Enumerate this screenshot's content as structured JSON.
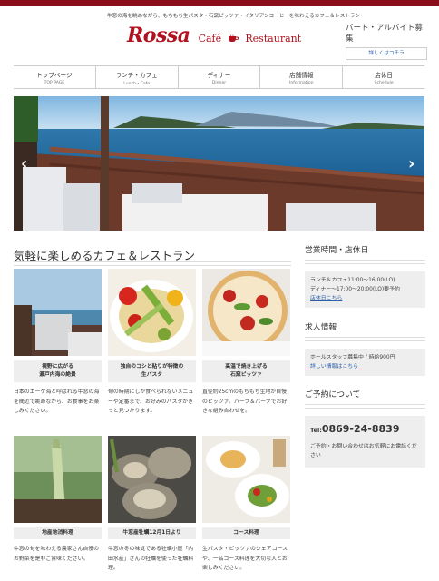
{
  "header": {
    "tagline": "牛窓の海を眺めながら、もちもち生パスタ・石窯ピッツァ・イタリアンコーヒーを味わえるカフェ＆レストラン",
    "logo_rossa": "Rossa",
    "logo_cafe": "Café",
    "logo_restaurant": "Restaurant",
    "recruit_title": "パート・アルバイト募集",
    "recruit_button": "詳しくはコチラ"
  },
  "nav": [
    {
      "ja": "トップページ",
      "en": "TOP PAGE"
    },
    {
      "ja": "ランチ・カフェ",
      "en": "Lunch・Cafe"
    },
    {
      "ja": "ディナー",
      "en": "Dinner"
    },
    {
      "ja": "店舗情報",
      "en": "Information"
    },
    {
      "ja": "店休日",
      "en": "Schedule"
    }
  ],
  "hero": {
    "prev": "‹",
    "next": "›"
  },
  "main": {
    "title": "気軽に楽しめるカフェ＆レストラン",
    "cards": [
      {
        "cap1": "視野に広がる",
        "cap2": "瀬戸内海の絶景",
        "desc": "日本のエーゲ海と呼ばれる牛窓の海を間近で眺めながら、お食事をお楽しみください。"
      },
      {
        "cap1": "独自のコシと粘りが特徴の",
        "cap2": "生パスタ",
        "desc": "旬の時期にしか食べられないメニューや定番まで、お好みのパスタがきっと見つかります。"
      },
      {
        "cap1": "高温で焼き上げる",
        "cap2": "石窯ピッツァ",
        "desc": "直径約25cmのもちもち生地が自慢のピッツァ。ハーブ＆パーブでお好きな組み合わせを。"
      },
      {
        "cap1": "地産地消料理",
        "cap2": "",
        "desc": "牛窓の旬を味わえる農家さん自慢のお野菜を是非ご賞味ください。"
      },
      {
        "cap1": "牛窓産牡蠣12月1日より",
        "cap2": "",
        "desc": "牛窓の冬の味覚である牡蠣小屋「内田水産」さんの牡蠣を使った牡蠣料理。"
      },
      {
        "cap1": "コース料理",
        "cap2": "",
        "desc": "生パスタ・ピッツァのシェアコースや、一品コース料理を大切な人とお楽しみください。"
      }
    ]
  },
  "sidebar": {
    "hours_title": "営業時間・店休日",
    "hours_lunch": "ランチ＆カフェ11:00〜16:00(LO)",
    "hours_dinner": "ディナー〜17:00〜20:00(LO)要予約",
    "hours_link": "店休日こちら",
    "jobs_title": "求人情報",
    "jobs_text": "ホールスタッフ募集中 / 時給900円",
    "jobs_link": "詳しい情報はこちら",
    "reserve_title": "ご予約について",
    "tel_label": "Tel:",
    "tel_number": "0869-24-8839",
    "reserve_note": "ご予約・お問い合わせはお気軽にお電話ください"
  },
  "colors": {
    "brand": "#b0121f",
    "topbar": "#8b0d1a",
    "link": "#2b5fa8"
  }
}
